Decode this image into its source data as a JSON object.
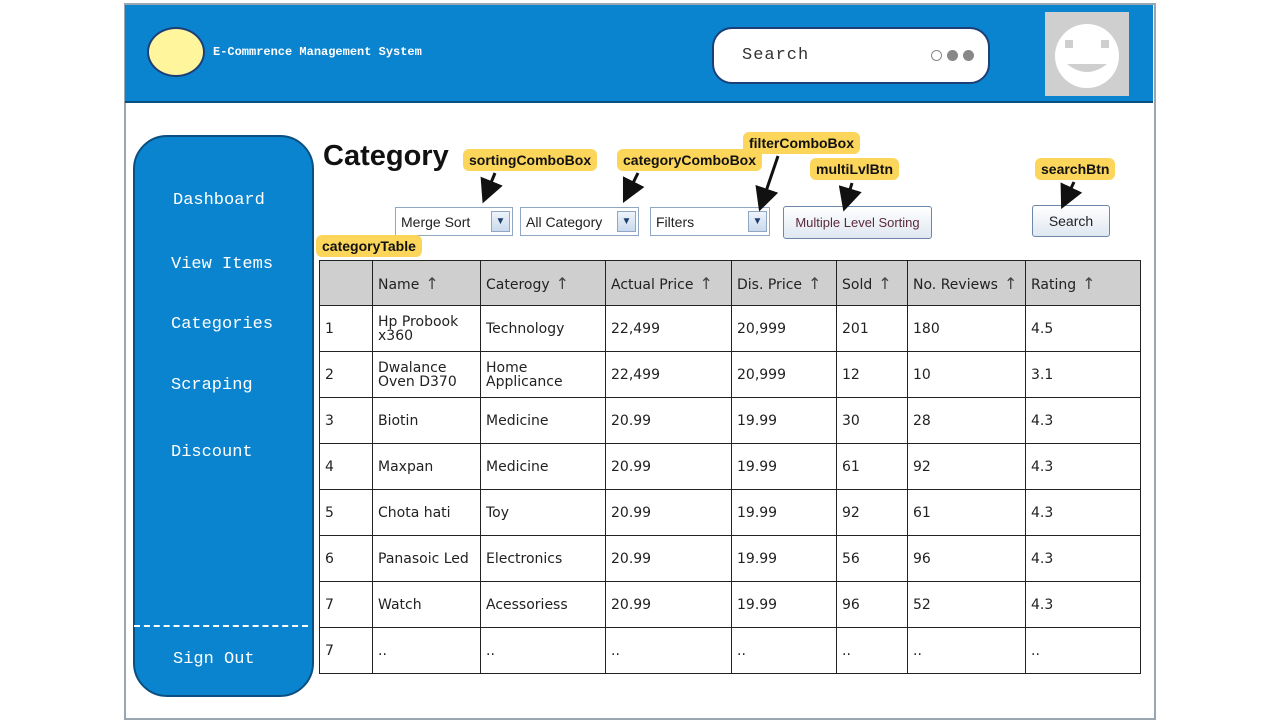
{
  "header": {
    "app_title": "E-Commrence Management System",
    "search_placeholder": "Search"
  },
  "sidebar": {
    "items": [
      {
        "label": "Dashboard"
      },
      {
        "label": "View Items"
      },
      {
        "label": "Categories"
      },
      {
        "label": "Scraping"
      },
      {
        "label": "Discount"
      }
    ],
    "sign_out": "Sign Out"
  },
  "main": {
    "title": "Category",
    "sorting_combo": "Merge Sort",
    "category_combo": "All Category",
    "filter_combo": "Filters",
    "multi_level_button": "Multiple Level Sorting",
    "search_button": "Search"
  },
  "callouts": {
    "sorting": "sortingComboBox",
    "category": "categoryComboBox",
    "filter": "filterComboBox",
    "multi": "multiLvlBtn",
    "search": "searchBtn",
    "table": "categoryTable"
  },
  "table": {
    "columns": [
      "",
      "Name",
      "Caterogy",
      "Actual Price",
      "Dis. Price",
      "Sold",
      "No. Reviews",
      "Rating"
    ],
    "rows": [
      [
        "1",
        "Hp Probook x360",
        "Technology",
        "22,499",
        "20,999",
        "201",
        "180",
        "4.5"
      ],
      [
        "2",
        "Dwalance Oven D370",
        "Home Applicance",
        "22,499",
        "20,999",
        "12",
        "10",
        "3.1"
      ],
      [
        "3",
        "Biotin",
        "Medicine",
        "20.99",
        "19.99",
        "30",
        "28",
        "4.3"
      ],
      [
        "4",
        "Maxpan",
        "Medicine",
        "20.99",
        "19.99",
        "61",
        "92",
        "4.3"
      ],
      [
        "5",
        "Chota hati",
        "Toy",
        "20.99",
        "19.99",
        "92",
        "61",
        "4.3"
      ],
      [
        "6",
        "Panasoic Led",
        "Electronics",
        "20.99",
        "19.99",
        "56",
        "96",
        "4.3"
      ],
      [
        "7",
        "Watch",
        "Acessoriess",
        "20.99",
        "19.99",
        "96",
        "52",
        "4.3"
      ],
      [
        "7",
        "..",
        "..",
        "..",
        "..",
        "..",
        "..",
        ".."
      ]
    ]
  },
  "colors": {
    "primary": "#0a84cf",
    "logo": "#fef59c",
    "callout": "#fcd65a",
    "table_header": "#cfcfcf"
  },
  "icons": {
    "sort": "up-arrow-icon",
    "combo": "chevron-down-icon",
    "avatar": "user-avatar-icon"
  }
}
